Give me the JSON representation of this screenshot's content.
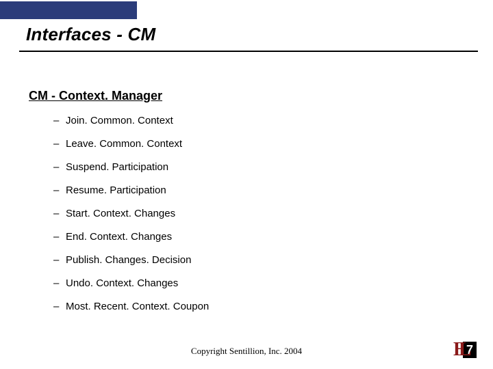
{
  "title": "Interfaces - CM",
  "subtitle": "CM - Context. Manager",
  "items": [
    "Join. Common. Context",
    "Leave. Common. Context",
    "Suspend. Participation",
    "Resume. Participation",
    "Start. Context. Changes",
    "End. Context. Changes",
    "Publish. Changes. Decision",
    "Undo. Context. Changes",
    "Most. Recent. Context. Coupon"
  ],
  "footer": "Copyright Sentillion, Inc. 2004",
  "logo": {
    "h": "H",
    "l": "L",
    "seven": "7"
  }
}
